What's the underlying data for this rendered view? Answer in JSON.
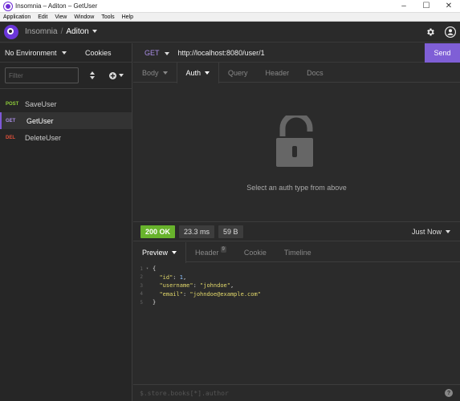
{
  "window": {
    "title": "Insomnia – Aditon – GetUser",
    "controls": {
      "minimize": "–",
      "maximize": "☐",
      "close": "✕"
    }
  },
  "menu": [
    "Application",
    "Edit",
    "View",
    "Window",
    "Tools",
    "Help"
  ],
  "header": {
    "app_name": "Insomnia",
    "separator": "/",
    "workspace": "Aditon",
    "icons": [
      "insomnia-logo",
      "gear-icon",
      "user-icon"
    ]
  },
  "sidebar": {
    "environment": "No Environment",
    "cookies": "Cookies",
    "filter_placeholder": "Filter",
    "requests": [
      {
        "method": "POST",
        "name": "SaveUser",
        "color": "#8fce3a",
        "active": false
      },
      {
        "method": "GET",
        "name": "GetUser",
        "color": "#a98de6",
        "active": true
      },
      {
        "method": "DEL",
        "name": "DeleteUser",
        "color": "#e0503a",
        "active": false
      }
    ]
  },
  "request": {
    "method": "GET",
    "url": "http://localhost:8080/user/1",
    "send": "Send",
    "tabs": [
      "Body",
      "Auth",
      "Query",
      "Header",
      "Docs"
    ],
    "active_tab": "Auth",
    "auth_message": "Select an auth type from above"
  },
  "response": {
    "status": "200 OK",
    "time": "23.3 ms",
    "size": "59 B",
    "history": "Just Now",
    "tabs": [
      "Preview",
      "Header",
      "Cookie",
      "Timeline"
    ],
    "header_count": "9",
    "line_numbers": [
      "1",
      "2",
      "3",
      "4",
      "5"
    ],
    "json": {
      "id_key": "\"id\"",
      "id_val": "1",
      "username_key": "\"username\"",
      "username_val": "\"johndoe\"",
      "email_key": "\"email\"",
      "email_val": "\"johndoe@example.com\""
    },
    "query_placeholder": "$.store.books[*].author",
    "help": "?"
  }
}
